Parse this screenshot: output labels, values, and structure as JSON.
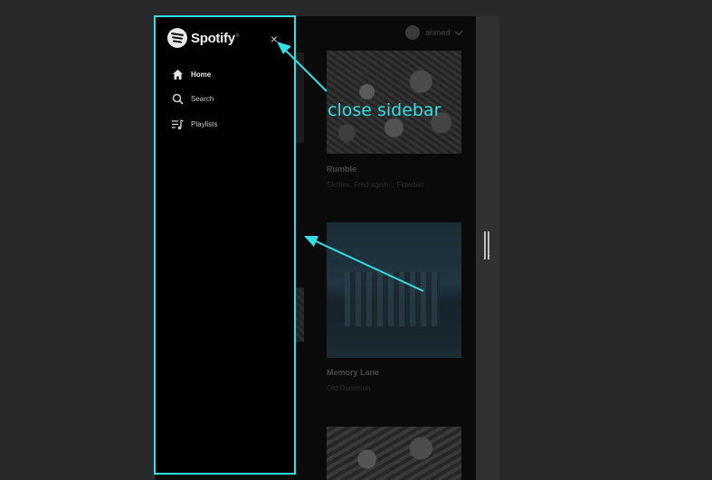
{
  "sidebar": {
    "logo_text": "Spotify",
    "logo_mark": "®",
    "close_glyph": "×",
    "items": [
      {
        "label": "Home",
        "icon": "home-icon"
      },
      {
        "label": "Search",
        "icon": "search-icon"
      },
      {
        "label": "Playlists",
        "icon": "playlists-icon"
      }
    ]
  },
  "header": {
    "user_name": "ahmed"
  },
  "cards": [
    {
      "title": "Rumble",
      "subtitle": "Skrillex, Fred again.., Flowdan"
    },
    {
      "title": "Memory Lane",
      "subtitle": "Old Dominion"
    }
  ],
  "annotation": {
    "label": "close sidebar",
    "color": "#33dfe3"
  }
}
